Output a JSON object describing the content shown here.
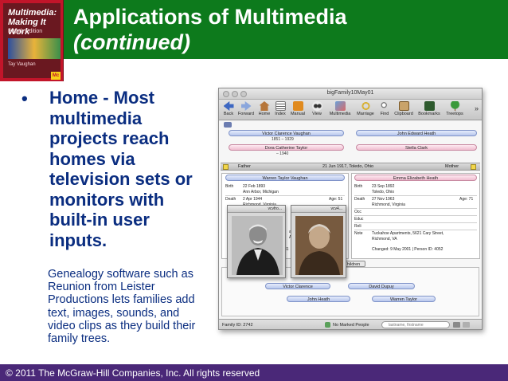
{
  "slide": {
    "title_line1": "Applications of Multimedia",
    "title_line2": "(continued)",
    "bullet_marker": "•",
    "bullet_text": "Home - Most multimedia projects reach homes via television sets or monitors with built-in user inputs.",
    "caption": "Genealogy software such as Reunion from Leister Productions lets families add text, images, sounds, and video clips as they build their family trees.",
    "footer": "© 2011 The McGraw-Hill Companies, Inc. All rights reserved",
    "colors": {
      "header": "#0d7a1c",
      "footer": "#4a2878",
      "body_text": "#0a2d80"
    }
  },
  "book_cover": {
    "title": "Multimedia: Making It Work",
    "edition": "Eighth Edition",
    "author": "Tay Vaughan",
    "logo": "Mc"
  },
  "app": {
    "window_title": "bigFamily10May01",
    "toolbar": [
      {
        "label": "Back",
        "icon": "back-arrow-icon"
      },
      {
        "label": "Forward",
        "icon": "forward-arrow-icon"
      },
      {
        "label": "Home",
        "icon": "home-icon"
      },
      {
        "label": "Index",
        "icon": "index-icon"
      },
      {
        "label": "Manual",
        "icon": "manual-icon"
      },
      {
        "label": "View",
        "icon": "view-icon"
      },
      {
        "label": "Multimedia",
        "icon": "multimedia-icon"
      },
      {
        "label": "Marriage",
        "icon": "marriage-icon"
      },
      {
        "label": "Find",
        "icon": "find-icon"
      },
      {
        "label": "Clipboard",
        "icon": "clipboard-icon"
      },
      {
        "label": "Bookmarks",
        "icon": "bookmarks-icon"
      },
      {
        "label": "Treetops",
        "icon": "treetops-icon"
      }
    ],
    "overflow": "»",
    "ancestors": {
      "paternal_grandfather": "Victor Clarence Vaughan",
      "paternal_grandfather_dates": "1851 – 1929",
      "paternal_grandmother": "Dora Catherine Taylor",
      "paternal_grandmother_dates": "– 1940",
      "maternal_grandfather": "John Edward Heath",
      "maternal_grandmother": "Stella Clark"
    },
    "father_bar": {
      "label": "Father",
      "marriage": "21 Jun 1917, Toledo, Ohio"
    },
    "mother_bar": {
      "label": "Mother"
    },
    "father": {
      "name": "Warren Taylor Vaughan",
      "birth_label": "Birth",
      "birth_date": "22 Feb 1893",
      "birth_place": "Ann Arbor, Michigan",
      "death_label": "Death",
      "death_date": "2 Apr 1944",
      "death_age": "Age: 51",
      "death_place": "Richmond, Virginia",
      "notes_fragment_1": "an",
      "notes_fragment_2": "A",
      "id_fragment": "81"
    },
    "mother": {
      "name": "Emma Elizabeth Heath",
      "birth_label": "Birth",
      "birth_date": "23 Sep 1892",
      "birth_place": "Toledo, Ohio",
      "death_label": "Death",
      "death_date": "27 Nov 1963",
      "death_age": "Age: 71",
      "death_place": "Richmond, Virginia",
      "occ_label": "Occ",
      "educ_label": "Educ",
      "reli_label": "Reli",
      "note_label": "Note",
      "note_text_1": "Tuckahoe Apartments, 5621 Cary Street,",
      "note_text_2": "Richmond, VA",
      "changed": "Changed: 9 May 2001 | Person ID: 4052"
    },
    "photo_windows": [
      {
        "title": "vcvfro..."
      },
      {
        "title": "vcv4..."
      }
    ],
    "children_popup": "Children",
    "children": [
      {
        "name": "Victor Clarence",
        "color": "blue"
      },
      {
        "name": "David Dupuy",
        "color": "blue"
      },
      {
        "name": "John Heath",
        "color": "blue"
      },
      {
        "name": "Warren Taylor",
        "color": "blue"
      }
    ],
    "status": {
      "family_id": "Family ID: 2742",
      "marked": "No Marked People",
      "search_placeholder": "lastname, firstname"
    }
  }
}
